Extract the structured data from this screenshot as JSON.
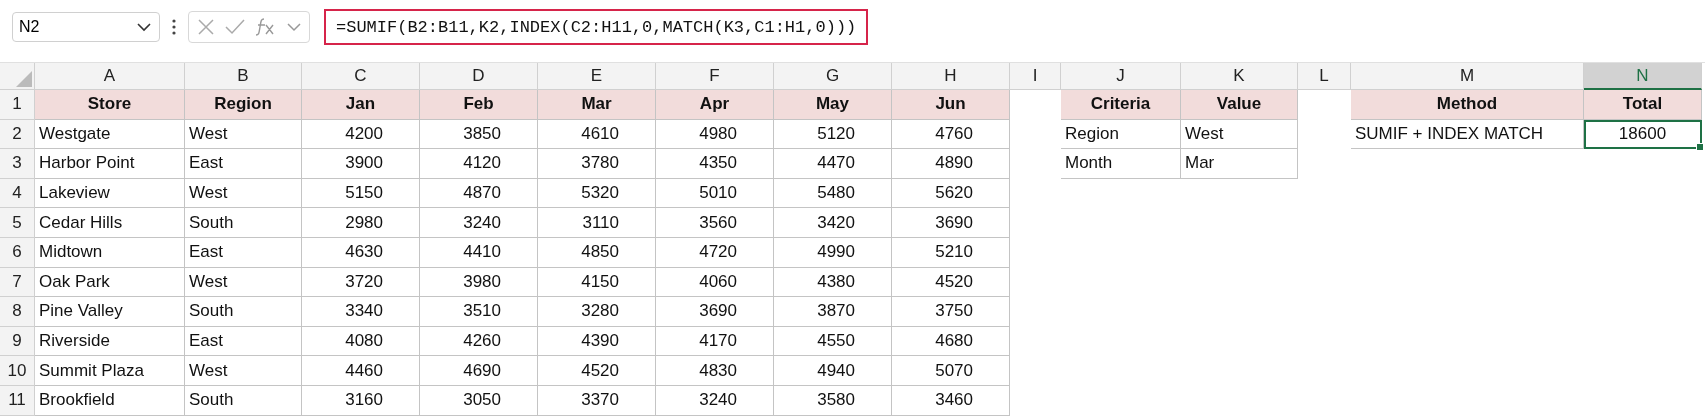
{
  "name_box": {
    "value": "N2"
  },
  "formula": {
    "value": "=SUMIF(B2:B11,K2,INDEX(C2:H11,0,MATCH(K3,C1:H1,0)))"
  },
  "columns": [
    {
      "label": "A",
      "selected": false
    },
    {
      "label": "B",
      "selected": false
    },
    {
      "label": "C",
      "selected": false
    },
    {
      "label": "D",
      "selected": false
    },
    {
      "label": "E",
      "selected": false
    },
    {
      "label": "F",
      "selected": false
    },
    {
      "label": "G",
      "selected": false
    },
    {
      "label": "H",
      "selected": false
    },
    {
      "label": "I",
      "selected": false
    },
    {
      "label": "J",
      "selected": false
    },
    {
      "label": "K",
      "selected": false
    },
    {
      "label": "L",
      "selected": false
    },
    {
      "label": "M",
      "selected": false
    },
    {
      "label": "N",
      "selected": true
    }
  ],
  "rows": [
    {
      "label": "1",
      "cells": [
        {
          "text": "Store",
          "kind": "header"
        },
        {
          "text": "Region",
          "kind": "header"
        },
        {
          "text": "Jan",
          "kind": "header"
        },
        {
          "text": "Feb",
          "kind": "header"
        },
        {
          "text": "Mar",
          "kind": "header"
        },
        {
          "text": "Apr",
          "kind": "header"
        },
        {
          "text": "May",
          "kind": "header"
        },
        {
          "text": "Jun",
          "kind": "header"
        },
        null,
        {
          "text": "Criteria",
          "kind": "header"
        },
        {
          "text": "Value",
          "kind": "header"
        },
        null,
        {
          "text": "Method",
          "kind": "header"
        },
        {
          "text": "Total",
          "kind": "header"
        }
      ]
    },
    {
      "label": "2",
      "cells": [
        {
          "text": "Westgate",
          "kind": "text"
        },
        {
          "text": "West",
          "kind": "text"
        },
        {
          "text": "4200",
          "kind": "number"
        },
        {
          "text": "3850",
          "kind": "number"
        },
        {
          "text": "4610",
          "kind": "number"
        },
        {
          "text": "4980",
          "kind": "number"
        },
        {
          "text": "5120",
          "kind": "number"
        },
        {
          "text": "4760",
          "kind": "number"
        },
        null,
        {
          "text": "Region",
          "kind": "text"
        },
        {
          "text": "West",
          "kind": "text"
        },
        null,
        {
          "text": "SUMIF + INDEX MATCH",
          "kind": "text"
        },
        {
          "text": "18600",
          "kind": "centered",
          "selected": true
        }
      ]
    },
    {
      "label": "3",
      "cells": [
        {
          "text": "Harbor Point",
          "kind": "text"
        },
        {
          "text": "East",
          "kind": "text"
        },
        {
          "text": "3900",
          "kind": "number"
        },
        {
          "text": "4120",
          "kind": "number"
        },
        {
          "text": "3780",
          "kind": "number"
        },
        {
          "text": "4350",
          "kind": "number"
        },
        {
          "text": "4470",
          "kind": "number"
        },
        {
          "text": "4890",
          "kind": "number"
        },
        null,
        {
          "text": "Month",
          "kind": "text"
        },
        {
          "text": "Mar",
          "kind": "text"
        },
        null,
        null,
        null
      ]
    },
    {
      "label": "4",
      "cells": [
        {
          "text": "Lakeview",
          "kind": "text"
        },
        {
          "text": "West",
          "kind": "text"
        },
        {
          "text": "5150",
          "kind": "number"
        },
        {
          "text": "4870",
          "kind": "number"
        },
        {
          "text": "5320",
          "kind": "number"
        },
        {
          "text": "5010",
          "kind": "number"
        },
        {
          "text": "5480",
          "kind": "number"
        },
        {
          "text": "5620",
          "kind": "number"
        },
        null,
        null,
        null,
        null,
        null,
        null
      ]
    },
    {
      "label": "5",
      "cells": [
        {
          "text": "Cedar Hills",
          "kind": "text"
        },
        {
          "text": "South",
          "kind": "text"
        },
        {
          "text": "2980",
          "kind": "number"
        },
        {
          "text": "3240",
          "kind": "number"
        },
        {
          "text": "3110",
          "kind": "number"
        },
        {
          "text": "3560",
          "kind": "number"
        },
        {
          "text": "3420",
          "kind": "number"
        },
        {
          "text": "3690",
          "kind": "number"
        },
        null,
        null,
        null,
        null,
        null,
        null
      ]
    },
    {
      "label": "6",
      "cells": [
        {
          "text": "Midtown",
          "kind": "text"
        },
        {
          "text": "East",
          "kind": "text"
        },
        {
          "text": "4630",
          "kind": "number"
        },
        {
          "text": "4410",
          "kind": "number"
        },
        {
          "text": "4850",
          "kind": "number"
        },
        {
          "text": "4720",
          "kind": "number"
        },
        {
          "text": "4990",
          "kind": "number"
        },
        {
          "text": "5210",
          "kind": "number"
        },
        null,
        null,
        null,
        null,
        null,
        null
      ]
    },
    {
      "label": "7",
      "cells": [
        {
          "text": "Oak Park",
          "kind": "text"
        },
        {
          "text": "West",
          "kind": "text"
        },
        {
          "text": "3720",
          "kind": "number"
        },
        {
          "text": "3980",
          "kind": "number"
        },
        {
          "text": "4150",
          "kind": "number"
        },
        {
          "text": "4060",
          "kind": "number"
        },
        {
          "text": "4380",
          "kind": "number"
        },
        {
          "text": "4520",
          "kind": "number"
        },
        null,
        null,
        null,
        null,
        null,
        null
      ]
    },
    {
      "label": "8",
      "cells": [
        {
          "text": "Pine Valley",
          "kind": "text"
        },
        {
          "text": "South",
          "kind": "text"
        },
        {
          "text": "3340",
          "kind": "number"
        },
        {
          "text": "3510",
          "kind": "number"
        },
        {
          "text": "3280",
          "kind": "number"
        },
        {
          "text": "3690",
          "kind": "number"
        },
        {
          "text": "3870",
          "kind": "number"
        },
        {
          "text": "3750",
          "kind": "number"
        },
        null,
        null,
        null,
        null,
        null,
        null
      ]
    },
    {
      "label": "9",
      "cells": [
        {
          "text": "Riverside",
          "kind": "text"
        },
        {
          "text": "East",
          "kind": "text"
        },
        {
          "text": "4080",
          "kind": "number"
        },
        {
          "text": "4260",
          "kind": "number"
        },
        {
          "text": "4390",
          "kind": "number"
        },
        {
          "text": "4170",
          "kind": "number"
        },
        {
          "text": "4550",
          "kind": "number"
        },
        {
          "text": "4680",
          "kind": "number"
        },
        null,
        null,
        null,
        null,
        null,
        null
      ]
    },
    {
      "label": "10",
      "cells": [
        {
          "text": "Summit Plaza",
          "kind": "text"
        },
        {
          "text": "West",
          "kind": "text"
        },
        {
          "text": "4460",
          "kind": "number"
        },
        {
          "text": "4690",
          "kind": "number"
        },
        {
          "text": "4520",
          "kind": "number"
        },
        {
          "text": "4830",
          "kind": "number"
        },
        {
          "text": "4940",
          "kind": "number"
        },
        {
          "text": "5070",
          "kind": "number"
        },
        null,
        null,
        null,
        null,
        null,
        null
      ]
    },
    {
      "label": "11",
      "cells": [
        {
          "text": "Brookfield",
          "kind": "text"
        },
        {
          "text": "South",
          "kind": "text"
        },
        {
          "text": "3160",
          "kind": "number"
        },
        {
          "text": "3050",
          "kind": "number"
        },
        {
          "text": "3370",
          "kind": "number"
        },
        {
          "text": "3240",
          "kind": "number"
        },
        {
          "text": "3580",
          "kind": "number"
        },
        {
          "text": "3460",
          "kind": "number"
        },
        null,
        null,
        null,
        null,
        null,
        null
      ]
    }
  ]
}
